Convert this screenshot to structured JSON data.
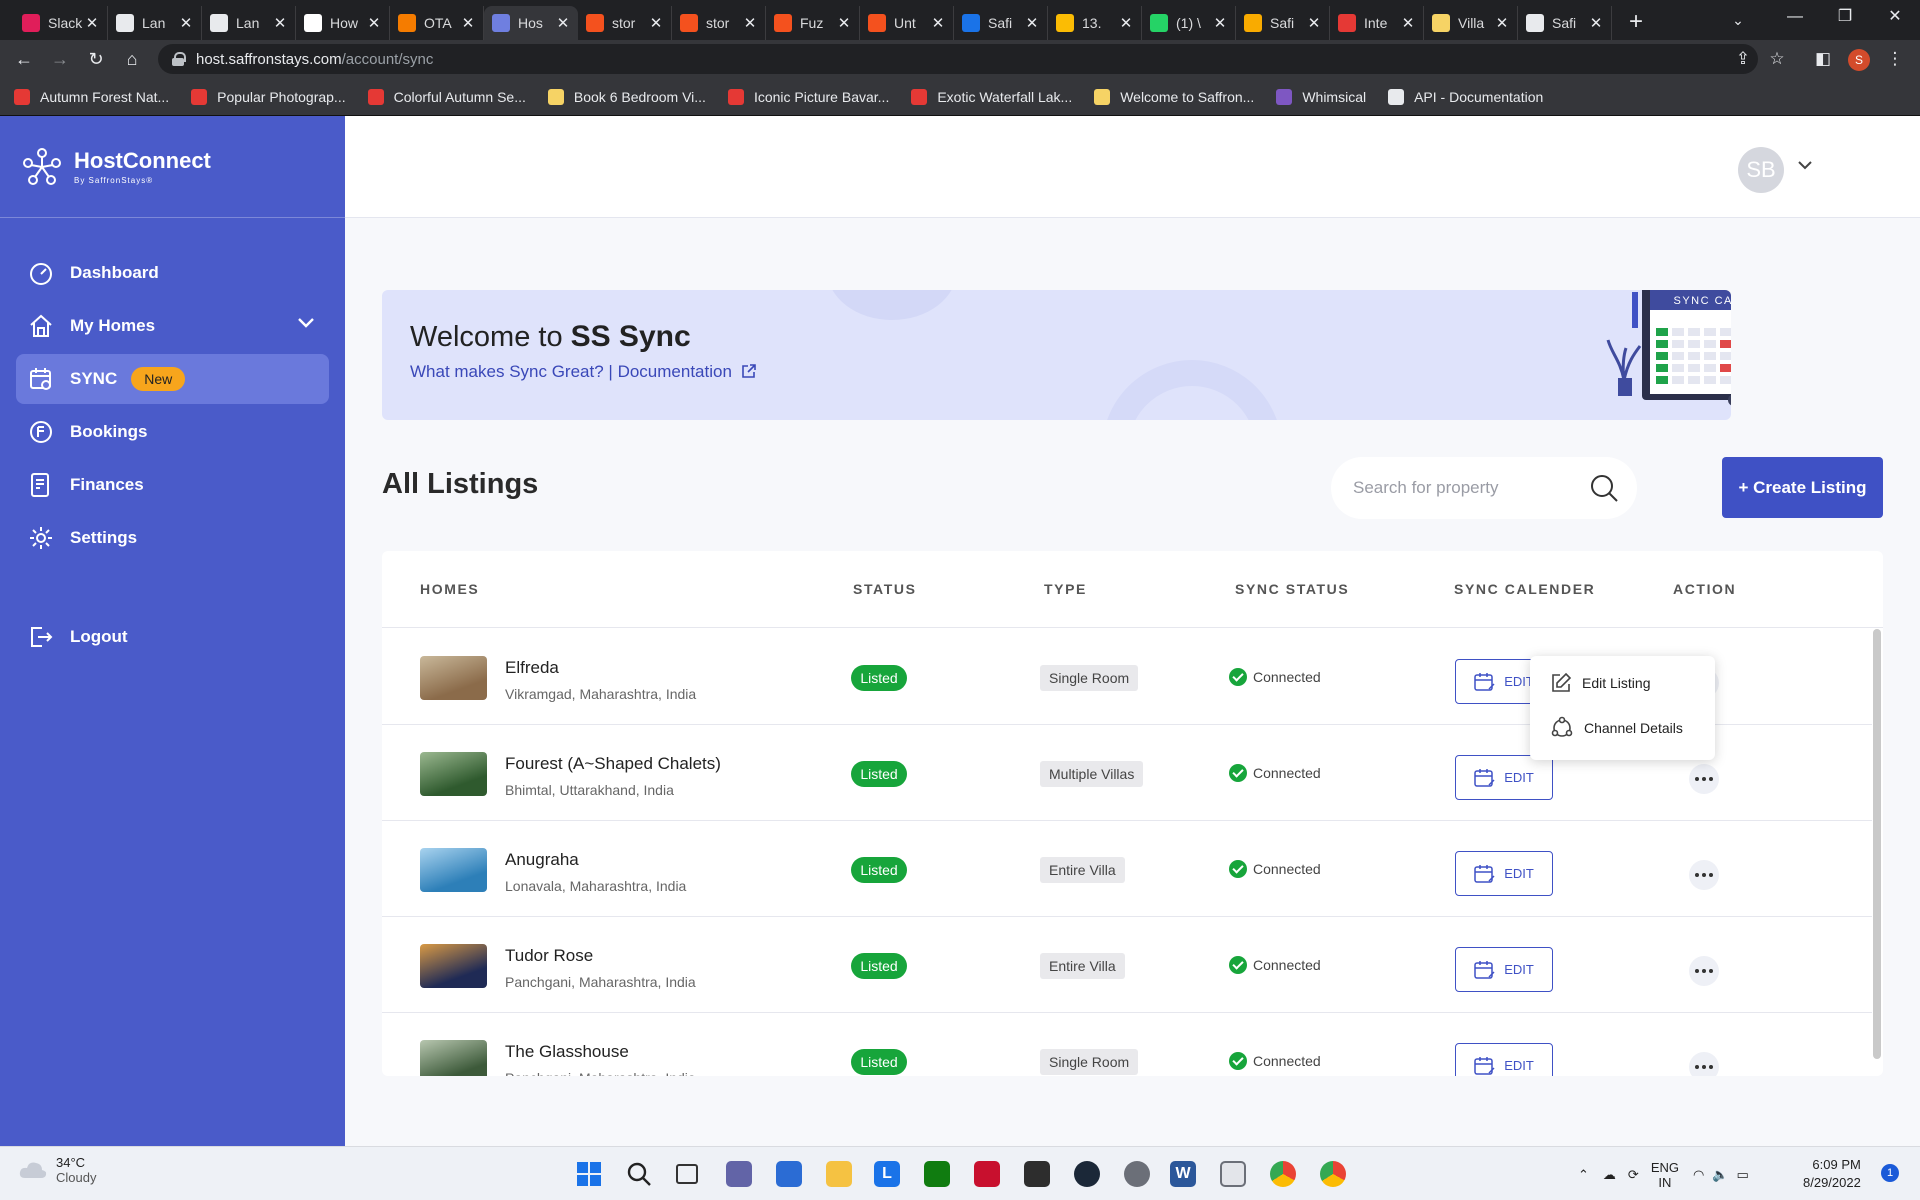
{
  "browser": {
    "tabs": [
      {
        "title": "Slack",
        "icon_color": "#e01e5a"
      },
      {
        "title": "Lan",
        "icon_color": "#e8eaed"
      },
      {
        "title": "Lan",
        "icon_color": "#e8eaed"
      },
      {
        "title": "How",
        "icon_color": "#ffffff"
      },
      {
        "title": "OTA",
        "icon_color": "#f57c00"
      },
      {
        "title": "Hos",
        "icon_color": "#6f7fe0",
        "active": true
      },
      {
        "title": "stor",
        "icon_color": "#f4511e"
      },
      {
        "title": "stor",
        "icon_color": "#f4511e"
      },
      {
        "title": "Fuz",
        "icon_color": "#f4511e"
      },
      {
        "title": "Unt",
        "icon_color": "#f4511e"
      },
      {
        "title": "Safi",
        "icon_color": "#1a73e8"
      },
      {
        "title": "13.",
        "icon_color": "#fbbc04"
      },
      {
        "title": "(1) \\",
        "icon_color": "#25d366"
      },
      {
        "title": "Safi",
        "icon_color": "#f9ab00"
      },
      {
        "title": "Inte",
        "icon_color": "#e53935"
      },
      {
        "title": "Villa",
        "icon_color": "#f6d365"
      },
      {
        "title": "Safi",
        "icon_color": "#e8eaed"
      }
    ],
    "tab_close": "✕",
    "new_tab": "+",
    "url_host": "host.saffronstays.com",
    "url_path": "/account/sync",
    "profile_initial": "S",
    "bookmarks": [
      {
        "label": "Autumn Forest Nat...",
        "icon_color": "#e53935"
      },
      {
        "label": "Popular Photograp...",
        "icon_color": "#e53935"
      },
      {
        "label": "Colorful Autumn Se...",
        "icon_color": "#e53935"
      },
      {
        "label": "Book 6 Bedroom Vi...",
        "icon_color": "#f6d365"
      },
      {
        "label": "Iconic Picture Bavar...",
        "icon_color": "#e53935"
      },
      {
        "label": "Exotic Waterfall Lak...",
        "icon_color": "#e53935"
      },
      {
        "label": "Welcome to Saffron...",
        "icon_color": "#f6d365"
      },
      {
        "label": "Whimsical",
        "icon_color": "#7e57c2"
      },
      {
        "label": "API - Documentation",
        "icon_color": "#e8eaed"
      }
    ]
  },
  "app": {
    "brand": {
      "name": "HostConnect",
      "sub": "By SaffronStays®"
    },
    "nav": [
      {
        "label": "Dashboard",
        "icon": "dashboard-icon"
      },
      {
        "label": "My Homes",
        "icon": "home-icon"
      },
      {
        "label": "SYNC",
        "icon": "sync-calendar-icon",
        "badge": "New",
        "active": true
      },
      {
        "label": "Bookings",
        "icon": "bookings-icon"
      },
      {
        "label": "Finances",
        "icon": "finances-icon"
      },
      {
        "label": "Settings",
        "icon": "gear-icon"
      },
      {
        "label": "Logout",
        "icon": "logout-icon"
      }
    ],
    "user": {
      "initials": "SB"
    },
    "banner": {
      "welcome": "Welcome to",
      "product": "SS Sync",
      "link1": "What makes Sync Great?",
      "separator": "|",
      "link2": "Documentation",
      "illustration_label": "SYNC CALENDAR"
    },
    "listings": {
      "title": "All Listings",
      "search_placeholder": "Search for property",
      "create_label": "+ Create Listing",
      "columns": [
        "HOMES",
        "STATUS",
        "TYPE",
        "SYNC STATUS",
        "SYNC CALENDER",
        "ACTION"
      ],
      "edit_label": "EDIT",
      "rows": [
        {
          "name": "Elfreda",
          "location": "Vikramgad, Maharashtra, India",
          "status": "Listed",
          "type": "Single Room",
          "sync": "Connected",
          "thumb": [
            "#8b6b4a",
            "#c9b89a"
          ]
        },
        {
          "name": "Fourest (A~Shaped Chalets)",
          "location": "Bhimtal, Uttarakhand, India",
          "status": "Listed",
          "type": "Multiple Villas",
          "sync": "Connected",
          "thumb": [
            "#2f5a2e",
            "#9bb890"
          ]
        },
        {
          "name": "Anugraha",
          "location": "Lonavala, Maharashtra, India",
          "status": "Listed",
          "type": "Entire Villa",
          "sync": "Connected",
          "thumb": [
            "#2d7fb8",
            "#a9d3ef"
          ]
        },
        {
          "name": "Tudor Rose",
          "location": "Panchgani, Maharashtra, India",
          "status": "Listed",
          "type": "Entire Villa",
          "sync": "Connected",
          "thumb": [
            "#1f2a55",
            "#d99a45"
          ]
        },
        {
          "name": "The Glasshouse",
          "location": "Panchgani, Maharashtra, India",
          "status": "Listed",
          "type": "Single Room",
          "sync": "Connected",
          "thumb": [
            "#3d5a3a",
            "#b8c7b0"
          ]
        }
      ],
      "context_menu": [
        "Edit Listing",
        "Channel Details"
      ]
    }
  },
  "taskbar": {
    "temp": "34°C",
    "condition": "Cloudy",
    "lang1": "ENG",
    "lang2": "IN",
    "time": "6:09 PM",
    "date": "8/29/2022",
    "notifications": "1"
  }
}
